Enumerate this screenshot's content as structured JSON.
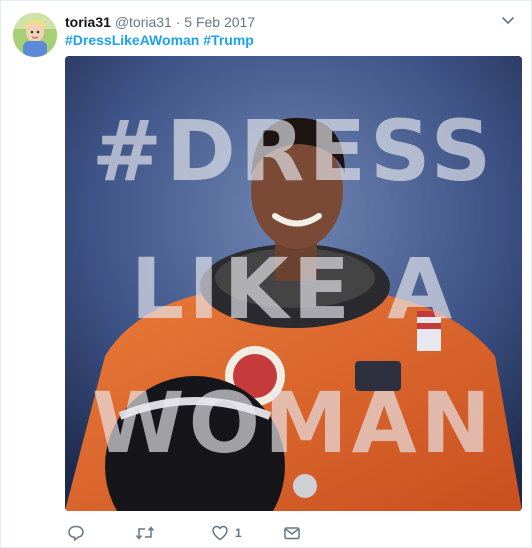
{
  "tweet": {
    "display_name": "toria31",
    "handle": "@toria31",
    "separator": "·",
    "date": "5 Feb 2017",
    "hashtags": [
      "#DressLikeAWoman",
      "#Trump"
    ],
    "image_text": [
      "#DRESS",
      "LIKE A",
      "WOMAN"
    ],
    "likes": "1"
  },
  "icons": {
    "avatar": "avatar-image",
    "caret": "chevron-down-icon",
    "reply": "reply-icon",
    "retweet": "retweet-icon",
    "like": "heart-icon",
    "dm": "envelope-icon"
  },
  "colors": {
    "link": "#1da1f2",
    "muted": "#657786",
    "text": "#14171a",
    "suit": "#e2692f"
  }
}
